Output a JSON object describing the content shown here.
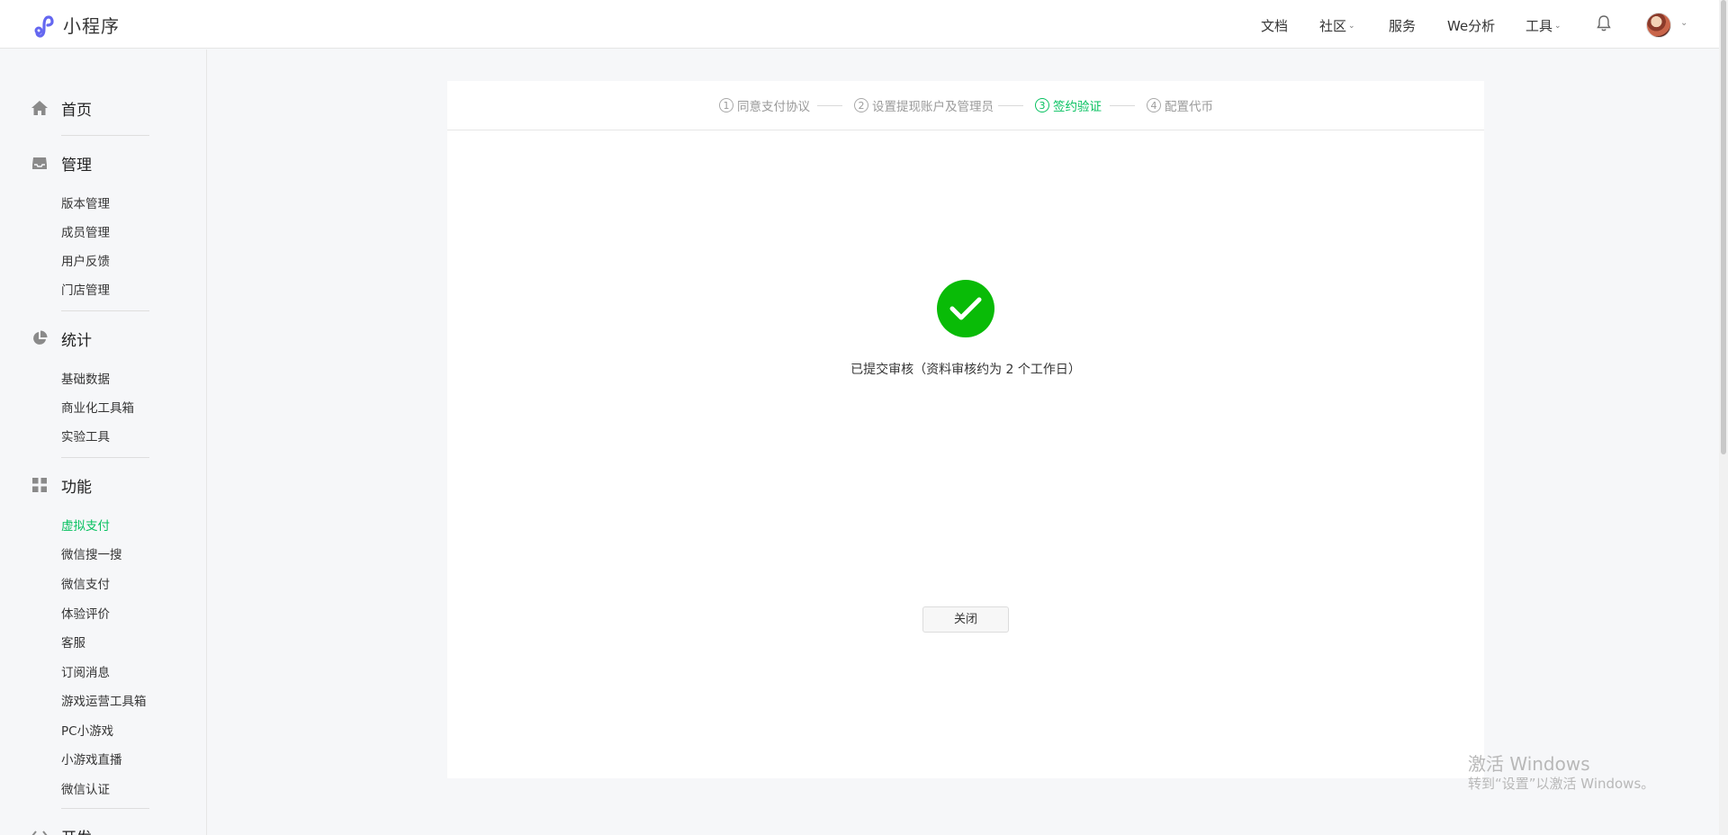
{
  "header": {
    "logo_text": "小程序",
    "nav": {
      "docs": "文档",
      "community": "社区",
      "services": "服务",
      "we_analytics": "We分析",
      "tools": "工具"
    }
  },
  "sidebar": {
    "home": "首页",
    "manage": {
      "label": "管理",
      "items": [
        "版本管理",
        "成员管理",
        "用户反馈",
        "门店管理"
      ]
    },
    "stats": {
      "label": "统计",
      "items": [
        "基础数据",
        "商业化工具箱",
        "实验工具"
      ]
    },
    "features": {
      "label": "功能",
      "items": [
        "虚拟支付",
        "微信搜一搜",
        "微信支付",
        "体验评价",
        "客服",
        "订阅消息",
        "游戏运营工具箱",
        "PC小游戏",
        "小游戏直播",
        "微信认证"
      ],
      "active": "虚拟支付"
    },
    "dev": {
      "label": "开发"
    }
  },
  "steps": [
    {
      "num": "1",
      "label": "同意支付协议"
    },
    {
      "num": "2",
      "label": "设置提现账户及管理员"
    },
    {
      "num": "3",
      "label": "签约验证"
    },
    {
      "num": "4",
      "label": "配置代币"
    }
  ],
  "current_step": "3",
  "result": {
    "message": "已提交审核（资料审核约为 2 个工作日）",
    "close_label": "关闭"
  },
  "watermark": {
    "line1": "激活 Windows",
    "line2": "转到“设置”以激活 Windows。"
  },
  "colors": {
    "accent": "#07c160",
    "success": "#09bb07",
    "logo": "#6467f0"
  }
}
